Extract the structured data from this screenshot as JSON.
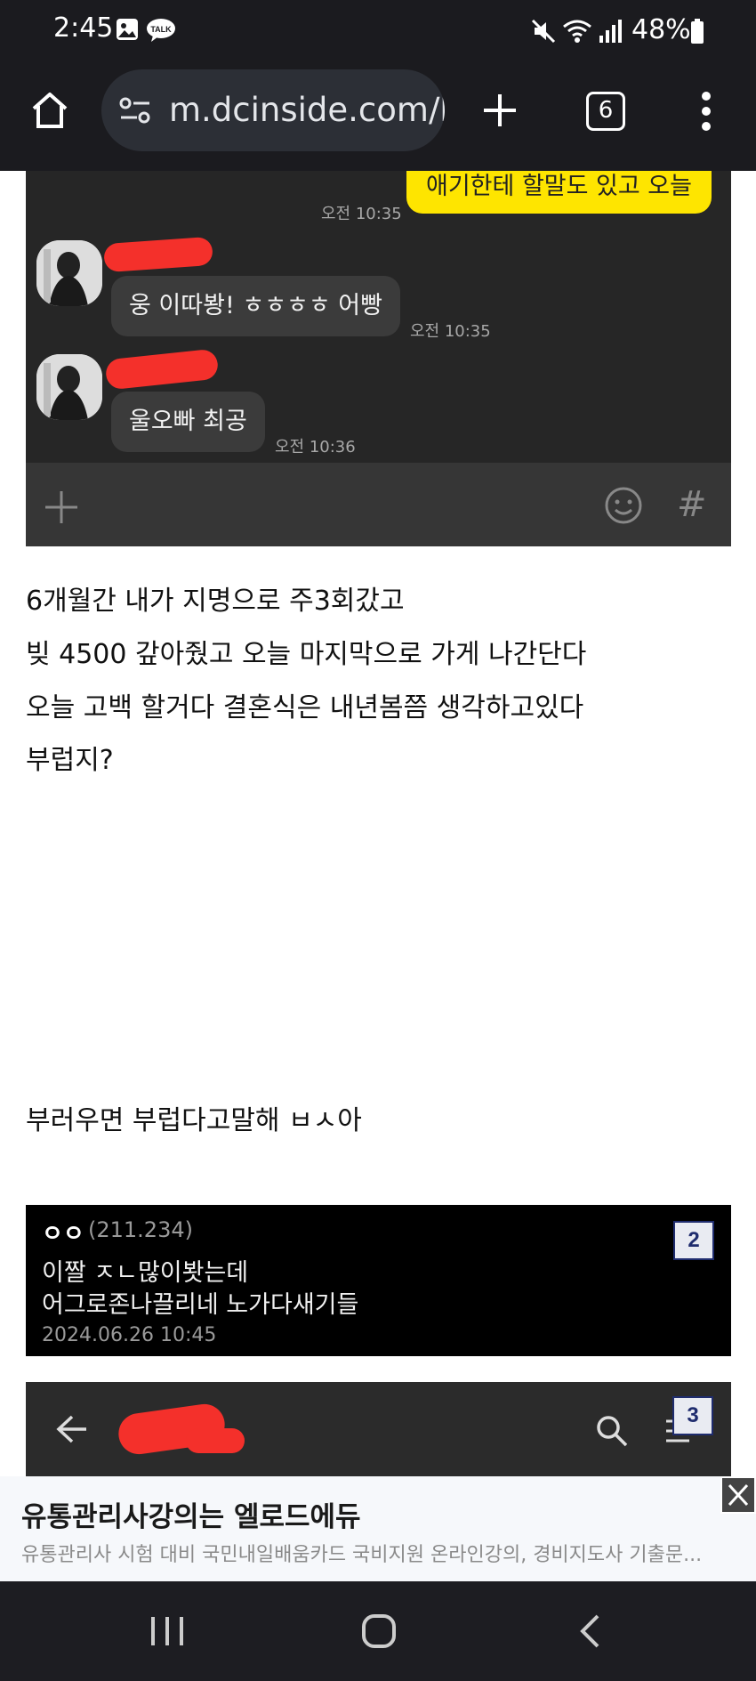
{
  "status_bar": {
    "time": "2:45",
    "battery": "48%"
  },
  "browser": {
    "url": "m.dcinside.com/b",
    "tab_count": "6"
  },
  "chat": {
    "my_message": "애기한테 할말도 있고 오늘",
    "my_time": "오전 10:35",
    "messages": [
      {
        "text": "웅 이따봥! ㅎㅎㅎㅎ 어빵",
        "time": "오전 10:35"
      },
      {
        "text": "울오빠 최공",
        "time": "오전 10:36"
      }
    ],
    "input_icons": [
      "plus-icon",
      "emoji-icon",
      "hash-icon"
    ]
  },
  "post": {
    "lines": [
      "6개월간 내가 지명으로 주3회갔고",
      "빚 4500 갚아줬고 오늘 마지막으로 가게 나간단다",
      "오늘 고백 할거다 결혼식은 내년봄쯤 생각하고있다",
      "부럽지?"
    ],
    "closing": "부러우면 부럽다고말해 ㅂㅅ아"
  },
  "comment": {
    "author": "ㅇㅇ",
    "ip": "(211.234)",
    "line1": "이짤 ㅈㄴ많이봣는데",
    "line2": "어그로존나끌리네 노가다새기들",
    "date": "2024.06.26 10:45",
    "badge": "2"
  },
  "next_image": {
    "badge": "3"
  },
  "ad": {
    "title": "유통관리사강의는 엘로드에듀",
    "description": "유통관리사 시험 대비 국민내일배움카드 국비지원 온라인강의, 경비지도사 기출문..."
  },
  "colors": {
    "kakao_yellow": "#fee500",
    "chat_bg": "#262626",
    "redaction": "#f4302b"
  }
}
